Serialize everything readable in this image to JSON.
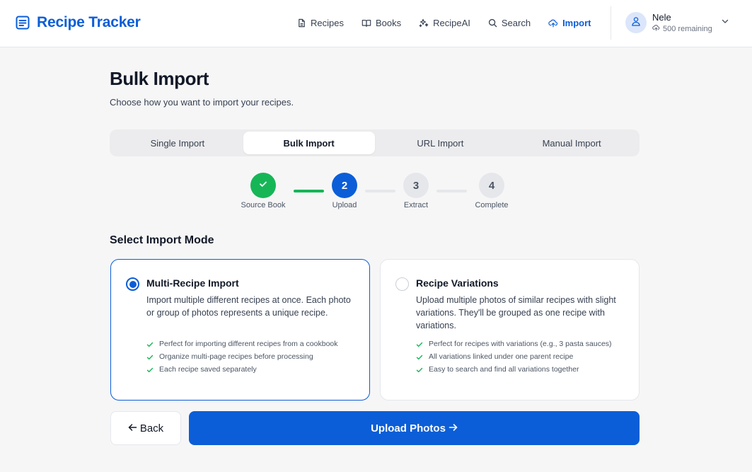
{
  "brand": {
    "name": "Recipe Tracker",
    "icon": "document-lines-icon"
  },
  "nav": [
    {
      "label": "Recipes",
      "icon": "file-icon",
      "active": false
    },
    {
      "label": "Books",
      "icon": "book-open-icon",
      "active": false
    },
    {
      "label": "RecipeAI",
      "icon": "sparkles-icon",
      "active": false
    },
    {
      "label": "Search",
      "icon": "search-icon",
      "active": false
    },
    {
      "label": "Import",
      "icon": "upload-cloud-icon",
      "active": true
    }
  ],
  "user": {
    "name": "Nele",
    "remaining": "500 remaining"
  },
  "page": {
    "title": "Bulk Import",
    "subtitle": "Choose how you want to import your recipes."
  },
  "tabs": [
    {
      "label": "Single Import",
      "active": false
    },
    {
      "label": "Bulk Import",
      "active": true
    },
    {
      "label": "URL Import",
      "active": false
    },
    {
      "label": "Manual Import",
      "active": false
    }
  ],
  "steps": [
    {
      "number": "",
      "label": "Source Book",
      "state": "done"
    },
    {
      "number": "2",
      "label": "Upload",
      "state": "current"
    },
    {
      "number": "3",
      "label": "Extract",
      "state": "pending"
    },
    {
      "number": "4",
      "label": "Complete",
      "state": "pending"
    }
  ],
  "section": {
    "title": "Select Import Mode"
  },
  "modes": [
    {
      "title": "Multi-Recipe Import",
      "description": "Import multiple different recipes at once. Each photo or group of photos represents a unique recipe.",
      "selected": true,
      "bullets": [
        "Perfect for importing different recipes from a cookbook",
        "Organize multi-page recipes before processing",
        "Each recipe saved separately"
      ]
    },
    {
      "title": "Recipe Variations",
      "description": "Upload multiple photos of similar recipes with slight variations. They'll be grouped as one recipe with variations.",
      "selected": false,
      "bullets": [
        "Perfect for recipes with variations (e.g., 3 pasta sauces)",
        "All variations linked under one parent recipe",
        "Easy to search and find all variations together"
      ]
    }
  ],
  "actions": {
    "back": "Back",
    "upload": "Upload Photos"
  },
  "colors": {
    "primary": "#0b5ed7",
    "success": "#16b657",
    "muted": "#e5e7eb"
  }
}
